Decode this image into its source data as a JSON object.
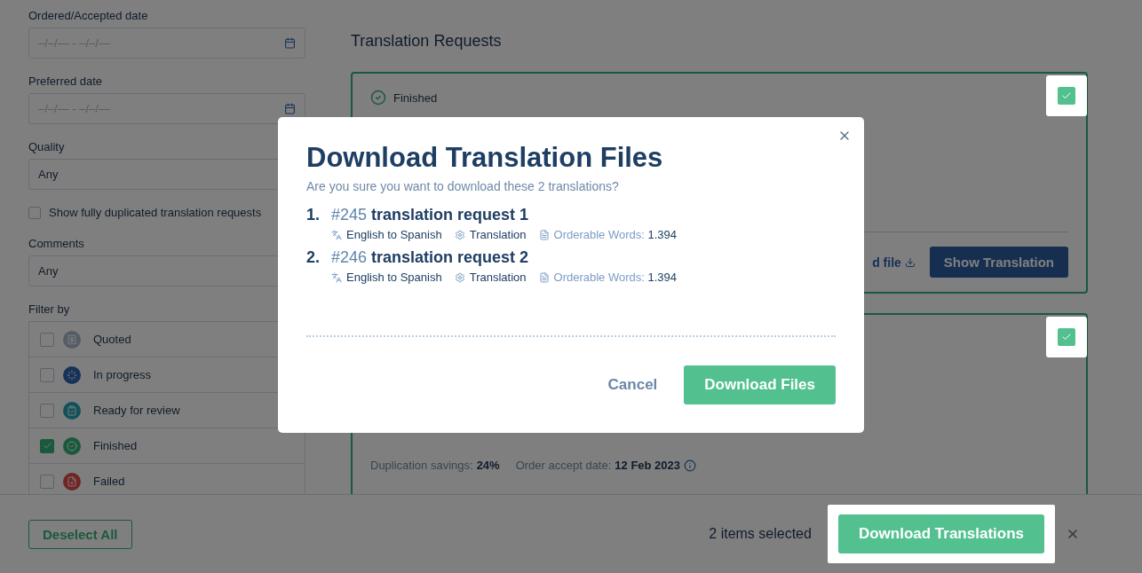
{
  "sidebar": {
    "fields": [
      {
        "label": "Ordered/Accepted date",
        "kind": "date",
        "placeholder": "–/–/— - –/–/—"
      },
      {
        "label": "Preferred date",
        "kind": "date",
        "placeholder": "–/–/— - –/–/—"
      },
      {
        "label": "Quality",
        "kind": "select",
        "value": "Any"
      },
      {
        "label": "Show fully duplicated translation requests",
        "kind": "checkbox",
        "checked": false
      },
      {
        "label": "Comments",
        "kind": "select",
        "value": "Any"
      }
    ],
    "filter": {
      "label": "Filter by",
      "items": [
        {
          "label": "Quoted",
          "checked": false,
          "kind": "quoted"
        },
        {
          "label": "In progress",
          "checked": false,
          "kind": "progress"
        },
        {
          "label": "Ready for review",
          "checked": false,
          "kind": "review"
        },
        {
          "label": "Finished",
          "checked": true,
          "kind": "finished"
        },
        {
          "label": "Failed",
          "checked": false,
          "kind": "failed"
        }
      ]
    }
  },
  "requests": {
    "title": "Translation Requests",
    "cards": [
      {
        "status": "Finished",
        "selected": true,
        "link": "d file",
        "button": "Show Translation"
      },
      {
        "selected": true,
        "details": [
          {
            "label": "Duplication savings:",
            "value": "24%"
          },
          {
            "label": "Order accept date:",
            "value": "12 Feb 2023"
          }
        ]
      }
    ]
  },
  "modal": {
    "title": "Download Translation Files",
    "subtitle": "Are you sure you want to download these 2 translations?",
    "items": [
      {
        "number": "1.",
        "id": "#245",
        "name": "translation request 1",
        "language": "English to Spanish",
        "service": "Translation",
        "words_label": "Orderable Words:",
        "words": "1.394"
      },
      {
        "number": "2.",
        "id": "#246",
        "name": "translation request 2",
        "language": "English to Spanish",
        "service": "Translation",
        "words_label": "Orderable Words:",
        "words": "1.394"
      }
    ],
    "cancel": "Cancel",
    "confirm": "Download Files"
  },
  "bottom_bar": {
    "deselect": "Deselect All",
    "count": "2 items selected",
    "download": "Download Translations"
  }
}
